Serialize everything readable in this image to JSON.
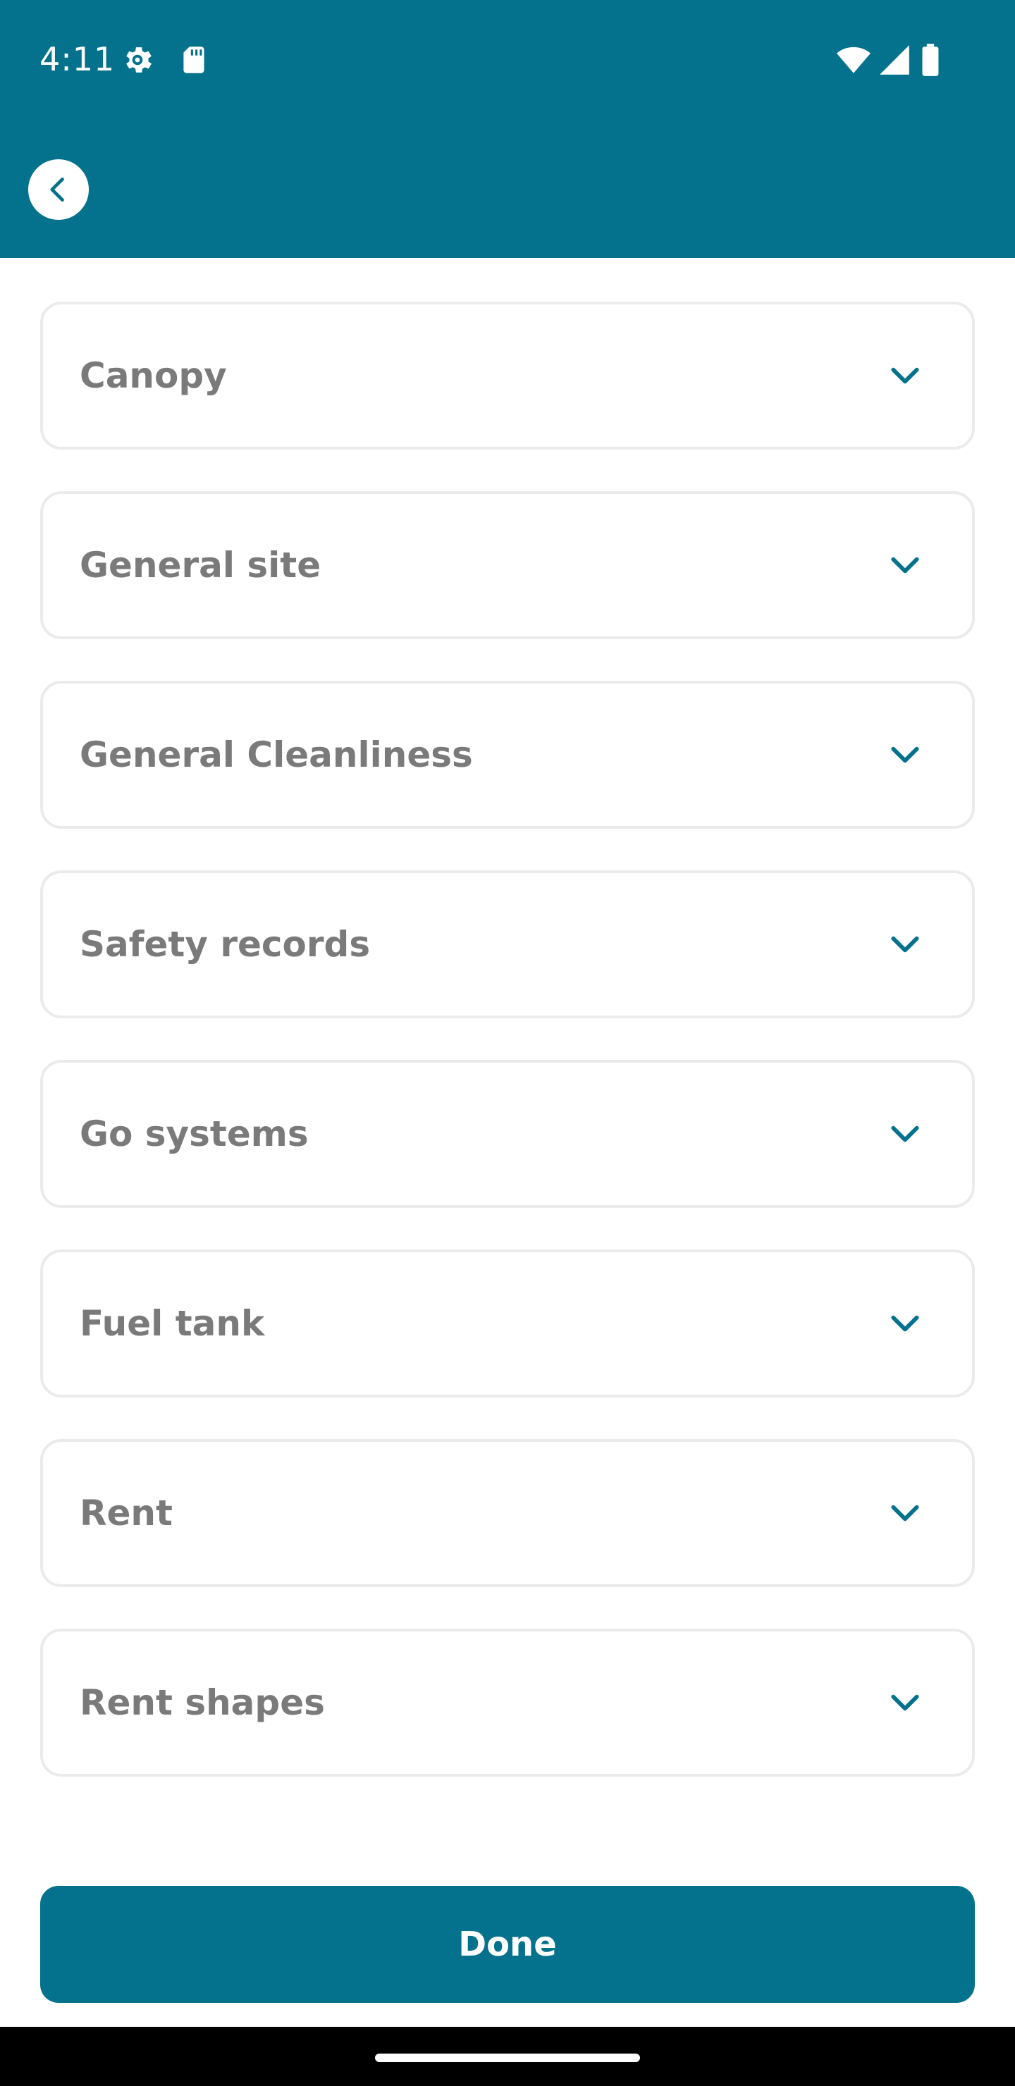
{
  "status_bar": {
    "time": "4:11",
    "left_icons": [
      "settings-gear-icon",
      "sd-card-icon"
    ],
    "right_icons": [
      "wifi-icon",
      "cellular-signal-icon",
      "battery-icon"
    ]
  },
  "header": {
    "back_icon": "chevron-left-icon",
    "background_color": "#04728d"
  },
  "sections": [
    {
      "label": "Canopy",
      "icon": "chevron-down-icon"
    },
    {
      "label": "General site",
      "icon": "chevron-down-icon"
    },
    {
      "label": "General Cleanliness",
      "icon": "chevron-down-icon"
    },
    {
      "label": "Safety records",
      "icon": "chevron-down-icon"
    },
    {
      "label": "Go systems",
      "icon": "chevron-down-icon"
    },
    {
      "label": "Fuel tank",
      "icon": "chevron-down-icon"
    },
    {
      "label": "Rent",
      "icon": "chevron-down-icon"
    },
    {
      "label": "Rent shapes",
      "icon": "chevron-down-icon"
    }
  ],
  "footer": {
    "done_label": "Done"
  },
  "colors": {
    "accent": "#04728d",
    "label_text": "#7a7a7a",
    "row_border": "#ebebeb"
  }
}
